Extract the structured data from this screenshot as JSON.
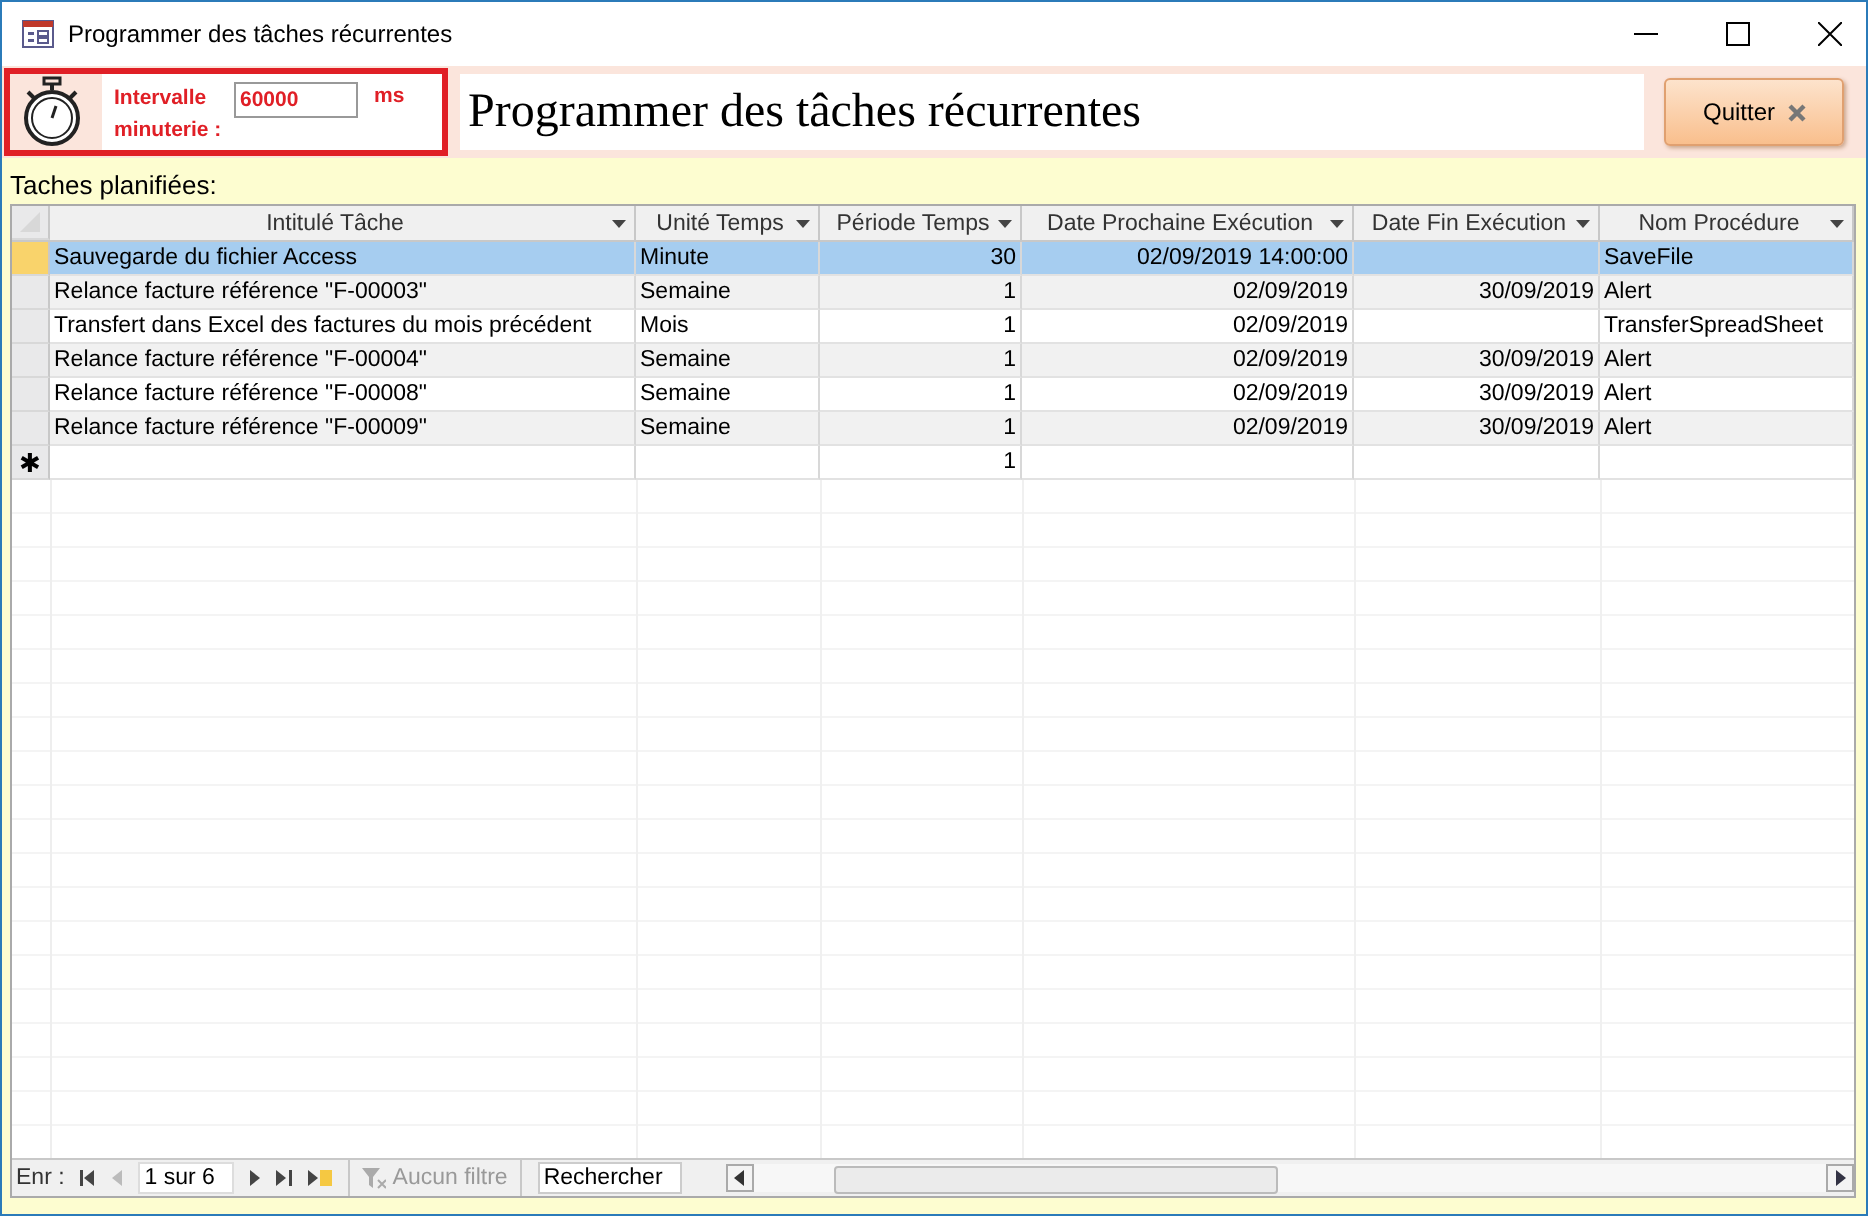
{
  "window": {
    "title": "Programmer des tâches récurrentes"
  },
  "header": {
    "interval_label": "Intervalle minuterie :",
    "interval_value": "60000",
    "interval_unit": "ms",
    "title": "Programmer des tâches récurrentes",
    "quit_button": "Quitter"
  },
  "section_label": "Taches planifiées:",
  "table": {
    "columns": [
      {
        "label": "Intitulé Tâche",
        "kind": "text"
      },
      {
        "label": "Unité Temps",
        "kind": "text"
      },
      {
        "label": "Période Temps",
        "kind": "number"
      },
      {
        "label": "Date Prochaine Exécution",
        "kind": "number"
      },
      {
        "label": "Date Fin Exécution",
        "kind": "number"
      },
      {
        "label": "Nom Procédure",
        "kind": "text"
      }
    ],
    "rows": [
      {
        "selected": true,
        "cells": [
          "Sauvegarde du fichier Access",
          "Minute",
          "30",
          "02/09/2019 14:00:00",
          null,
          "SaveFile"
        ]
      },
      {
        "selected": false,
        "cells": [
          "Relance facture référence \"F-00003\"",
          "Semaine",
          "1",
          "02/09/2019",
          "30/09/2019",
          "Alert"
        ]
      },
      {
        "selected": false,
        "cells": [
          "Transfert dans Excel des factures du mois précédent",
          "Mois",
          "1",
          "02/09/2019",
          null,
          "TransferSpreadSheet"
        ]
      },
      {
        "selected": false,
        "cells": [
          "Relance facture référence \"F-00004\"",
          "Semaine",
          "1",
          "02/09/2019",
          "30/09/2019",
          "Alert"
        ]
      },
      {
        "selected": false,
        "cells": [
          "Relance facture référence \"F-00008\"",
          "Semaine",
          "1",
          "02/09/2019",
          "30/09/2019",
          "Alert"
        ]
      },
      {
        "selected": false,
        "cells": [
          "Relance facture référence \"F-00009\"",
          "Semaine",
          "1",
          "02/09/2019",
          "30/09/2019",
          "Alert"
        ]
      }
    ],
    "new_record": {
      "marker": "✱",
      "cells": [
        null,
        null,
        "1",
        null,
        null,
        null
      ]
    }
  },
  "navigation": {
    "label": "Enr :",
    "position": "1 sur 6",
    "filter": "Aucun filtre",
    "filter_disabled": true,
    "search": "Rechercher"
  }
}
